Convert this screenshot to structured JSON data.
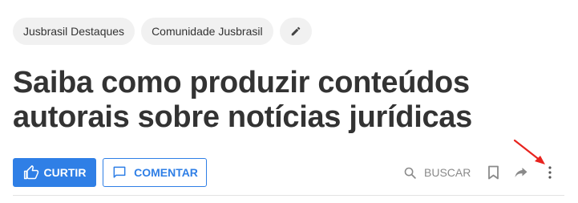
{
  "tags": [
    {
      "label": "Jusbrasil Destaques"
    },
    {
      "label": "Comunidade Jusbrasil"
    }
  ],
  "tag_edit_icon": "pencil-icon",
  "title": "Saiba como produzir conteúdos autorais sobre notícias jurídicas",
  "actions": {
    "like_label": "CURTIR",
    "like_icon": "thumbs-up-icon",
    "comment_label": "COMENTAR",
    "comment_icon": "comment-icon",
    "search_label": "BUSCAR",
    "search_icon": "search-icon",
    "bookmark_icon": "bookmark-icon",
    "share_icon": "share-icon",
    "more_icon": "more-vertical-icon"
  },
  "annotation": {
    "type": "arrow",
    "color": "#e8231e",
    "points_to": "more-options-button"
  },
  "colors": {
    "primary": "#2f7fe6",
    "text": "#333333",
    "muted": "#8a8a8a",
    "tag_bg": "#f1f1f1",
    "divider": "#e3e3e3"
  }
}
